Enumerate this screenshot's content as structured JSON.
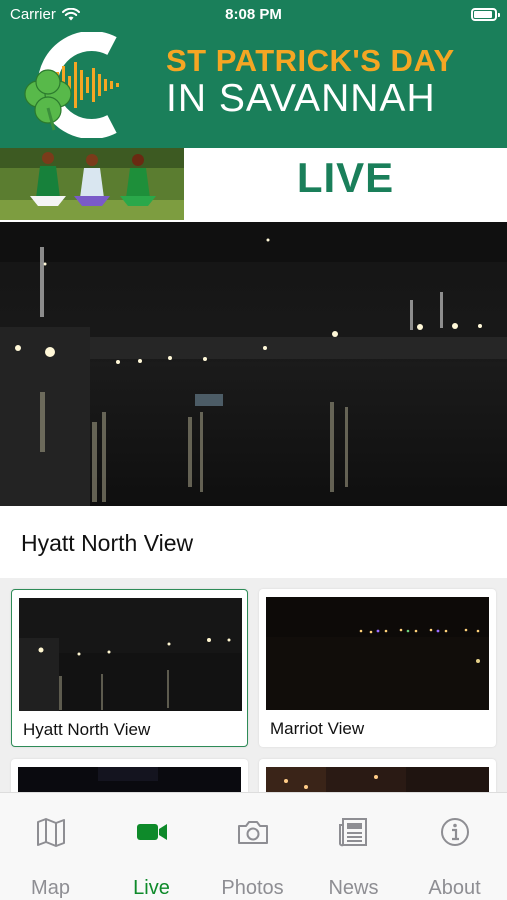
{
  "status_bar": {
    "carrier": "Carrier",
    "time": "8:08 PM"
  },
  "header": {
    "title_line1": "ST PATRICK'S DAY",
    "title_line2": "IN SAVANNAH",
    "logo_icon": "shamrock-c-logo-icon"
  },
  "live_banner": {
    "label": "LIVE"
  },
  "current_camera": {
    "title": "Hyatt North View"
  },
  "cameras": [
    {
      "label": "Hyatt North View",
      "selected": true
    },
    {
      "label": "Marriot View",
      "selected": false
    },
    {
      "label": "",
      "selected": false
    },
    {
      "label": "",
      "selected": false
    }
  ],
  "tabs": [
    {
      "label": "Map",
      "icon": "map-icon",
      "active": false
    },
    {
      "label": "Live",
      "icon": "video-camera-icon",
      "active": true
    },
    {
      "label": "Photos",
      "icon": "camera-icon",
      "active": false
    },
    {
      "label": "News",
      "icon": "newspaper-icon",
      "active": false
    },
    {
      "label": "About",
      "icon": "info-icon",
      "active": false
    }
  ],
  "colors": {
    "brand_green": "#1a7f5a",
    "accent_orange": "#f5a623",
    "active_tab": "#0e8a2a",
    "inactive_tab": "#8e8e93"
  }
}
